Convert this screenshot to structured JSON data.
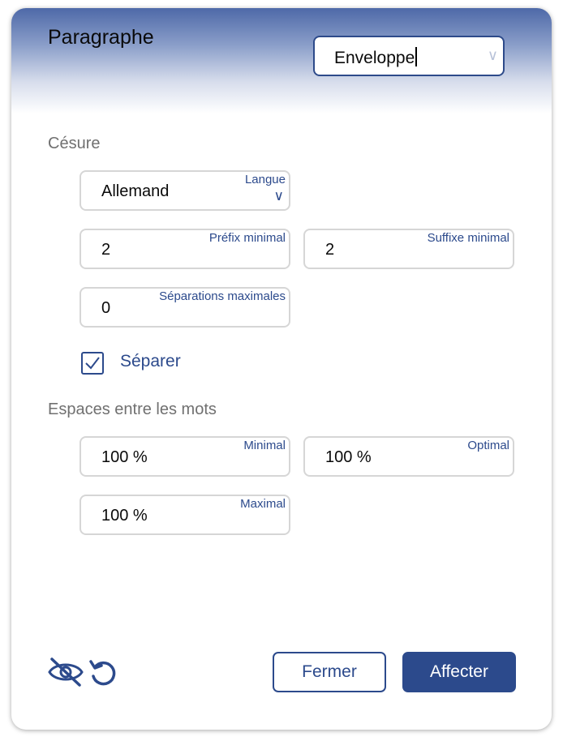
{
  "dialog": {
    "title": "Paragraphe",
    "style_select": {
      "value": "Enveloppe"
    }
  },
  "hyphenation": {
    "section_label": "Césure",
    "language": {
      "label": "Langue",
      "value": "Allemand"
    },
    "min_prefix": {
      "label": "Préfix minimal",
      "value": "2"
    },
    "min_suffix": {
      "label": "Suffixe minimal",
      "value": "2"
    },
    "max_separations": {
      "label": "Séparations maximales",
      "value": "0"
    },
    "separate": {
      "label": "Séparer",
      "checked": true
    }
  },
  "word_spacing": {
    "section_label": "Espaces entre les mots",
    "minimal": {
      "label": "Minimal",
      "value": "100 %"
    },
    "optimal": {
      "label": "Optimal",
      "value": "100 %"
    },
    "maximal": {
      "label": "Maximal",
      "value": "100 %"
    }
  },
  "footer": {
    "close_label": "Fermer",
    "apply_label": "Affecter",
    "icons": [
      "eye-slash-icon",
      "reset-icon"
    ]
  },
  "colors": {
    "accent": "#2c4a8c",
    "header_gradient_top": "#4e69a8",
    "field_border": "#d6d6d6",
    "section_label": "#707070"
  }
}
